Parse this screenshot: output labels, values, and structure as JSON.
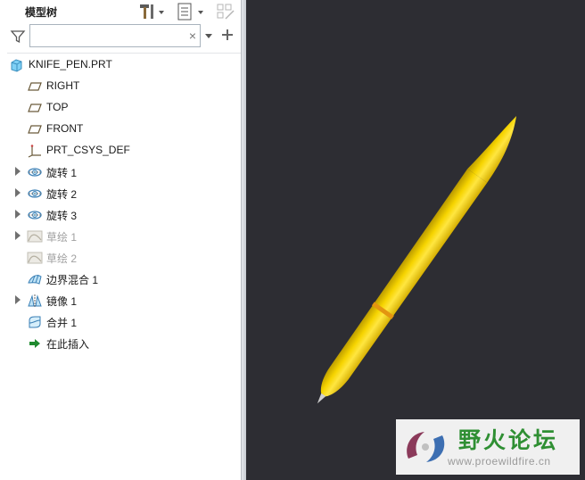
{
  "panel": {
    "title": "模型树",
    "search_value": "",
    "search_placeholder": ""
  },
  "tree": {
    "items": [
      {
        "label": "KNIFE_PEN.PRT",
        "icon": "part-icon",
        "expandable": false,
        "dimmed": false
      },
      {
        "label": "RIGHT",
        "icon": "datum-plane-icon",
        "expandable": false,
        "dimmed": false
      },
      {
        "label": "TOP",
        "icon": "datum-plane-icon",
        "expandable": false,
        "dimmed": false
      },
      {
        "label": "FRONT",
        "icon": "datum-plane-icon",
        "expandable": false,
        "dimmed": false
      },
      {
        "label": "PRT_CSYS_DEF",
        "icon": "coordinate-system-icon",
        "expandable": false,
        "dimmed": false
      },
      {
        "label": "旋转 1",
        "icon": "revolve-icon",
        "expandable": true,
        "dimmed": false
      },
      {
        "label": "旋转 2",
        "icon": "revolve-icon",
        "expandable": true,
        "dimmed": false
      },
      {
        "label": "旋转 3",
        "icon": "revolve-icon",
        "expandable": true,
        "dimmed": false
      },
      {
        "label": "草绘 1",
        "icon": "sketch-icon",
        "expandable": true,
        "dimmed": true
      },
      {
        "label": "草绘 2",
        "icon": "sketch-icon",
        "expandable": false,
        "dimmed": true
      },
      {
        "label": "边界混合 1",
        "icon": "boundary-blend-icon",
        "expandable": false,
        "dimmed": false
      },
      {
        "label": "镜像 1",
        "icon": "mirror-icon",
        "expandable": true,
        "dimmed": false
      },
      {
        "label": "合并 1",
        "icon": "merge-icon",
        "expandable": false,
        "dimmed": false
      },
      {
        "label": "在此插入",
        "icon": "insert-here-arrow-icon",
        "expandable": false,
        "dimmed": false
      }
    ]
  },
  "watermark": {
    "title": "野火论坛",
    "url": "www.proewildfire.cn"
  },
  "colors": {
    "viewport_background": "#2d2d33",
    "pen_yellow": "#f2cc00",
    "pen_band": "#e8a010",
    "watermark_green": "#2f8f33"
  }
}
